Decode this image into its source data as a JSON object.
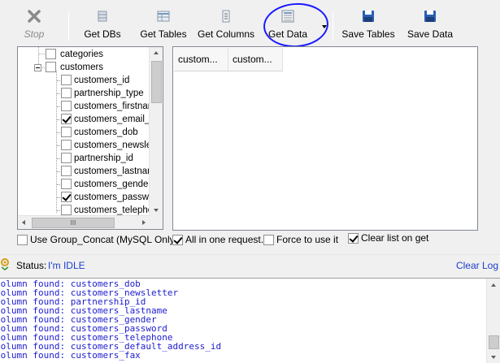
{
  "toolbar": {
    "stop": "Stop",
    "get_dbs": "Get DBs",
    "get_tables": "Get Tables",
    "get_columns": "Get Columns",
    "get_data": "Get Data",
    "save_tables": "Save Tables",
    "save_data": "Save Data"
  },
  "tree": {
    "nodes": [
      {
        "label": "categories",
        "checked": false
      },
      {
        "label": "customers",
        "checked": false
      },
      {
        "label": "customers_id",
        "checked": false
      },
      {
        "label": "partnership_type",
        "checked": false
      },
      {
        "label": "customers_firstname",
        "checked": false
      },
      {
        "label": "customers_email_ac",
        "checked": true
      },
      {
        "label": "customers_dob",
        "checked": false
      },
      {
        "label": "customers_newslette",
        "checked": false
      },
      {
        "label": "partnership_id",
        "checked": false
      },
      {
        "label": "customers_lastname",
        "checked": false
      },
      {
        "label": "customers_gender",
        "checked": false
      },
      {
        "label": "customers_passwor",
        "checked": true
      },
      {
        "label": "customers_telephon",
        "checked": false
      }
    ],
    "hscroll_thumb_glyph": "III"
  },
  "grid": {
    "columns": [
      "custom...",
      "custom..."
    ]
  },
  "options": {
    "group_concat": {
      "label": "Use Group_Concat (MySQL Only)",
      "checked": false
    },
    "all_in_one": {
      "label": "All in one request.",
      "checked": true
    },
    "force_use": {
      "label": "Force to use it",
      "checked": false
    },
    "clear_list": {
      "label": "Clear list on get",
      "checked": true
    }
  },
  "status": {
    "label": "Status:",
    "value": "I'm IDLE",
    "clear_log": "Clear Log"
  },
  "log": {
    "lines": [
      "Column found: customers_dob",
      "Column found: customers_newsletter",
      "Column found: partnership_id",
      "Column found: customers_lastname",
      "Column found: customers_gender",
      "Column found: customers_password",
      "Column found: customers_telephone",
      "Column found: customers_default_address_id",
      "Column found: customers_fax"
    ]
  },
  "colors": {
    "link": "#1c3ecc",
    "log_text": "#1c1ccf",
    "annotation_circle": "#1a1aff"
  }
}
